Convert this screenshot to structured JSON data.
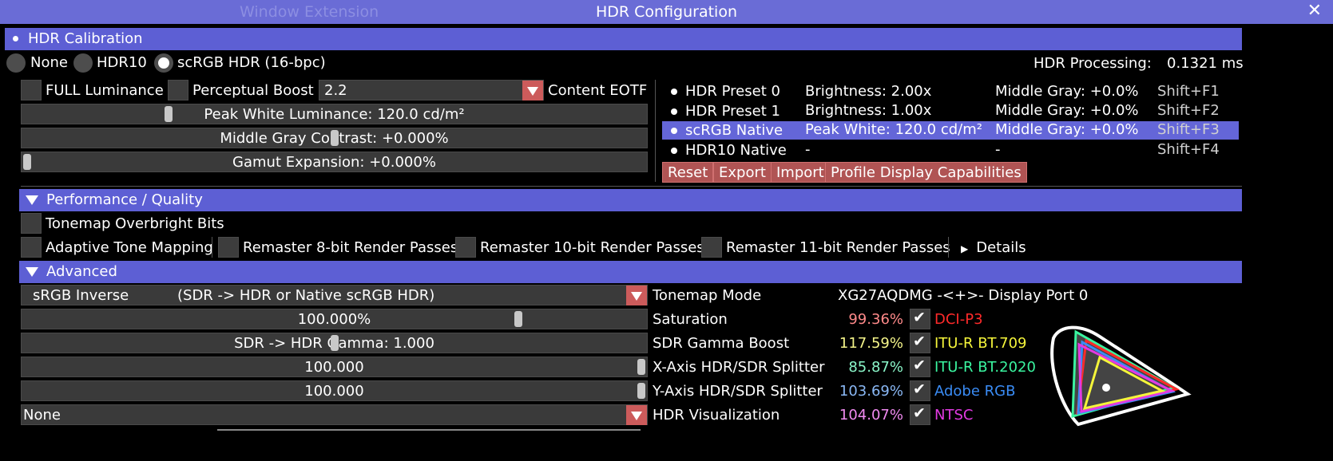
{
  "window": {
    "title": "HDR Configuration",
    "ghost_title": "Window Extension"
  },
  "calibration": {
    "header": "HDR Calibration",
    "modes": [
      "None",
      "HDR10",
      "scRGB HDR (16-bpc)"
    ],
    "processing_label": "HDR Processing:",
    "processing_value": "0.1321 ms",
    "full_luminance": "FULL Luminance",
    "perceptual_boost": "Perceptual Boost",
    "eotf_value": "2.2",
    "eotf_label": "Content EOTF",
    "peak_white": "Peak White Luminance: 120.0 cd/m²",
    "peak_white_fraction": 0.23,
    "middle_gray": "Middle Gray Contrast: +0.000%",
    "middle_gray_fraction": 0.5,
    "gamut": "Gamut Expansion: +0.000%",
    "gamut_fraction": 0.0,
    "presets": [
      {
        "name": "HDR Preset 0",
        "col2": "Brightness: 2.00x",
        "col3": "Middle Gray:  +0.0%",
        "key": "Shift+F1"
      },
      {
        "name": "HDR Preset 1",
        "col2": "Brightness: 1.00x",
        "col3": "Middle Gray:  +0.0%",
        "key": "Shift+F2"
      },
      {
        "name": "scRGB Native",
        "col2": "Peak White: 120.0 cd/m²",
        "col3": "Middle Gray:  +0.0%",
        "key": "Shift+F3"
      },
      {
        "name": "HDR10 Native",
        "col2": "-",
        "col3": "-",
        "key": "Shift+F4"
      }
    ],
    "buttons": [
      "Reset",
      "Export",
      "Import",
      "Profile Display Capabilities"
    ]
  },
  "performance": {
    "header": "Performance / Quality",
    "tonemap_overbright": "Tonemap Overbright Bits",
    "adaptive": "Adaptive Tone Mapping",
    "remaster8": "Remaster 8-bit Render Passes",
    "remaster10": "Remaster 10-bit Render Passes",
    "remaster11": "Remaster 11-bit Render Passes",
    "details": "Details"
  },
  "advanced": {
    "header": "Advanced",
    "tonemap_value_a": "sRGB Inverse",
    "tonemap_value_b": "(SDR -> HDR or Native scRGB HDR)",
    "tonemap_label": "Tonemap Mode",
    "display_name": "XG27AQDMG -<+>- Display Port 0",
    "saturation_value": "100.000%",
    "saturation_fraction": 0.8,
    "saturation_label": "Saturation",
    "gamma_value": "SDR -> HDR Gamma: 1.000",
    "gamma_fraction": 0.5,
    "gamma_label": "SDR Gamma Boost",
    "xsplit_value": "100.000",
    "xsplit_fraction": 1.0,
    "xsplit_label": "X-Axis HDR/SDR Splitter",
    "ysplit_value": "100.000",
    "ysplit_fraction": 1.0,
    "ysplit_label": "Y-Axis HDR/SDR Splitter",
    "visual_value": "None",
    "visual_label": "HDR Visualization",
    "gamuts": [
      {
        "pct": "99.36%",
        "name": "DCI-P3",
        "color": "#ff2a2a",
        "pct_color": "#ff8a8a"
      },
      {
        "pct": "117.59%",
        "name": "ITU-R BT.709",
        "color": "#f5f53a",
        "pct_color": "#f5f58a"
      },
      {
        "pct": "85.87%",
        "name": "ITU-R BT.2020",
        "color": "#3af5a0",
        "pct_color": "#8af5c8"
      },
      {
        "pct": "103.69%",
        "name": "Adobe RGB",
        "color": "#3a8cf5",
        "pct_color": "#8ab8f5"
      },
      {
        "pct": "104.07%",
        "name": "NTSC",
        "color": "#e23ae2",
        "pct_color": "#f08af0"
      }
    ]
  }
}
